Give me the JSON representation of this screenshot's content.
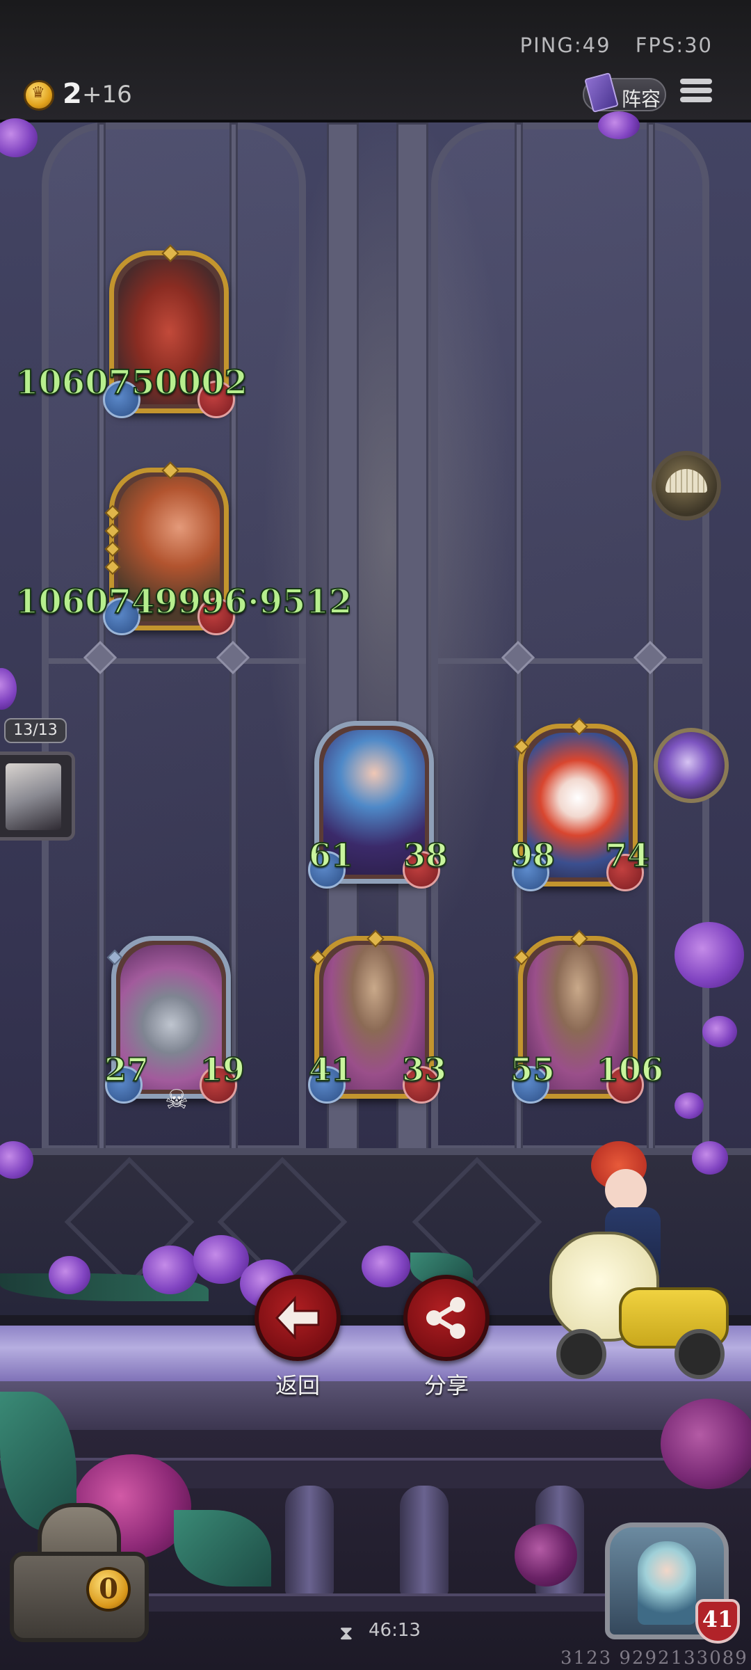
{
  "hud": {
    "ping": "PING:49",
    "fps": "FPS:30",
    "coins": "2",
    "coin_income": "+16",
    "lineup_label": "阵容",
    "menu_icon": "hamburger-menu-icon"
  },
  "left_column_units": [
    {
      "id": "dragon",
      "damage_label": "1060750002",
      "frame": "gold"
    },
    {
      "id": "archer",
      "damage_label": "1060749996·9512",
      "frame": "gold"
    }
  ],
  "board_units": [
    {
      "id": "blue-haired-mage",
      "attack": "61",
      "health": "38",
      "frame": "silver"
    },
    {
      "id": "clown",
      "attack": "98",
      "health": "74",
      "frame": "gold"
    },
    {
      "id": "robot-bell",
      "attack": "27",
      "health": "19",
      "frame": "silver"
    },
    {
      "id": "airship-1",
      "attack": "41",
      "health": "33",
      "frame": "gold"
    },
    {
      "id": "airship-2",
      "attack": "55",
      "health": "106",
      "frame": "gold"
    }
  ],
  "enemy_counter": "13/13",
  "actions": {
    "back_label": "返回",
    "share_label": "分享"
  },
  "chest_coin": "0",
  "timer": "46:13",
  "hero_health": "41",
  "footer_id": "3123 9292133089",
  "colors": {
    "stat_text": "#c9f59d",
    "gold_frame": "#c3952e",
    "silver_frame": "#8fa0b8",
    "button_red": "#9a1a1e"
  }
}
